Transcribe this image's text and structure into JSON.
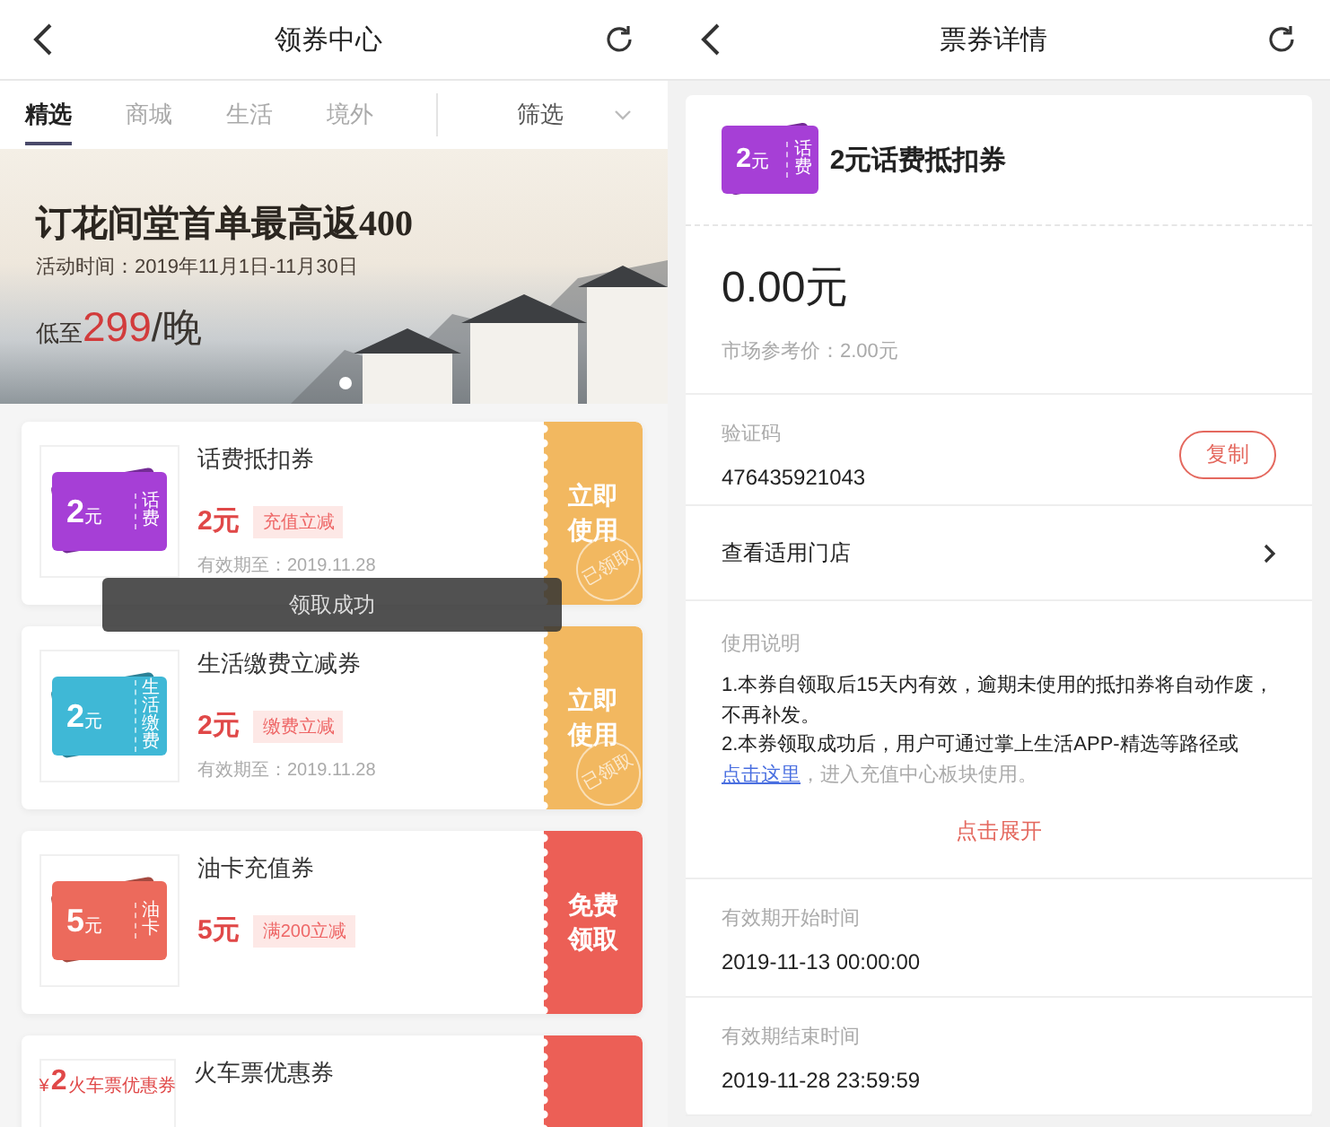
{
  "left_screen": {
    "header": {
      "title": "领券中心"
    },
    "tabs": [
      {
        "label": "精选",
        "selected": true
      },
      {
        "label": "商城",
        "selected": false
      },
      {
        "label": "生活",
        "selected": false
      },
      {
        "label": "境外",
        "selected": false
      }
    ],
    "filter": {
      "label": "筛选"
    },
    "banner": {
      "headline": "订花间堂首单最高返400",
      "period": "活动时间：2019年11月1日-11月30日",
      "price_prefix": "低至",
      "price": "299",
      "price_suffix": "/晚"
    },
    "coupons": [
      {
        "ticket": {
          "kind": "stacked",
          "value": "2",
          "unit": "元",
          "label": "话费",
          "color": "#a63fd6"
        },
        "title": "话费抵扣券",
        "price": "2元",
        "tag": "充值立减",
        "expiry": "有效期至：2019.11.28",
        "action": {
          "kind": "use",
          "label": "立即使用"
        },
        "stamp": "已领取"
      },
      {
        "ticket": {
          "kind": "stacked",
          "value": "2",
          "unit": "元",
          "label": "生活缴费",
          "color": "#3fb8d6"
        },
        "title": "生活缴费立减券",
        "price": "2元",
        "tag": "缴费立减",
        "expiry": "有效期至：2019.11.28",
        "action": {
          "kind": "use",
          "label": "立即使用"
        },
        "stamp": "已领取"
      },
      {
        "ticket": {
          "kind": "stacked",
          "value": "5",
          "unit": "元",
          "label": "油卡",
          "color": "#ec6a5c"
        },
        "title": "油卡充值券",
        "price": "5元",
        "tag": "满200立减",
        "action": {
          "kind": "claim",
          "label": "免费领取"
        }
      },
      {
        "ticket": {
          "kind": "plain",
          "value": "2",
          "unit": "¥",
          "label": "火车票优惠券",
          "color": "#e04848"
        },
        "title": "火车票优惠券",
        "action": {
          "kind": "claim"
        }
      }
    ],
    "toast": "领取成功"
  },
  "right_screen": {
    "header": {
      "title": "票券详情"
    },
    "coupon": {
      "ticket": {
        "value": "2",
        "unit": "元",
        "label": "话费",
        "color": "#a63fd6"
      },
      "name": "2元话费抵扣券"
    },
    "price": "0.00元",
    "market_price": "市场参考价：2.00元",
    "code": {
      "label": "验证码",
      "value": "476435921043",
      "button": "复制"
    },
    "stores_link": "查看适用门店",
    "instructions": {
      "label": "使用说明",
      "line_1": "1.本券自领取后15天内有效，逾期未使用的抵扣券将自动作废，不再补发。",
      "line_2": "2.本券领取成功后，用户可通过掌上生活APP-精选等路径或",
      "link": "点击这里",
      "line_2_tail": "，进入充值中心板块使用。",
      "expand": "点击展开"
    },
    "validity": [
      {
        "label": "有效期开始时间",
        "value": "2019-11-13 00:00:00"
      },
      {
        "label": "有效期结束时间",
        "value": "2019-11-28 23:59:59"
      }
    ]
  }
}
